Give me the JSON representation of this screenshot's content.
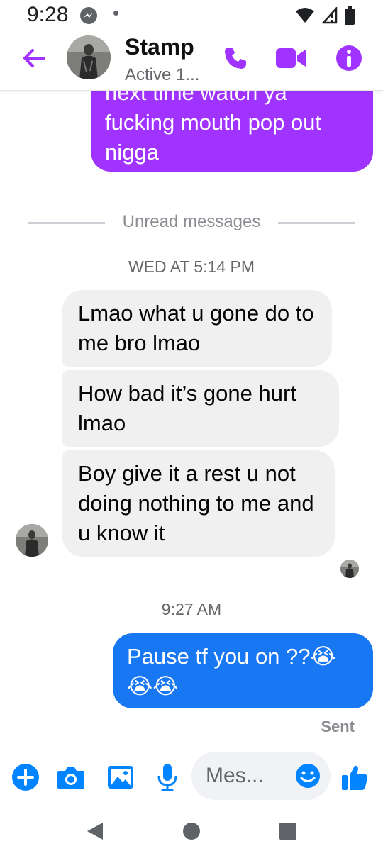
{
  "status_bar": {
    "time": "9:28"
  },
  "header": {
    "contact_name": "Stamp",
    "contact_status": "Active 1...",
    "accent_color": "#a033ff"
  },
  "messages": {
    "outgoing_partial": "next time watch ya fucking mouth pop out nigga",
    "unread_divider": "Unread messages",
    "timestamp_1": "WED AT 5:14 PM",
    "incoming": [
      "Lmao what u gone do to me bro lmao",
      "How bad it’s gone hurt lmao",
      "Boy give it a rest u not doing nothing to me and u know it"
    ],
    "timestamp_2": "9:27 AM",
    "outgoing_last": "Pause tf you on ??😭😭😭",
    "sent_status": "Sent",
    "colors": {
      "purple_bubble": "#a033ff",
      "blue_bubble": "#1877f2",
      "incoming_bubble": "#f0f0f0"
    }
  },
  "composer": {
    "placeholder": "Mes...",
    "icons": [
      "plus-icon",
      "camera-icon",
      "gallery-icon",
      "microphone-icon",
      "emoji-icon",
      "thumbs-up-icon"
    ]
  },
  "nav": {
    "icons": [
      "back-triangle-icon",
      "home-circle-icon",
      "recents-square-icon"
    ]
  }
}
